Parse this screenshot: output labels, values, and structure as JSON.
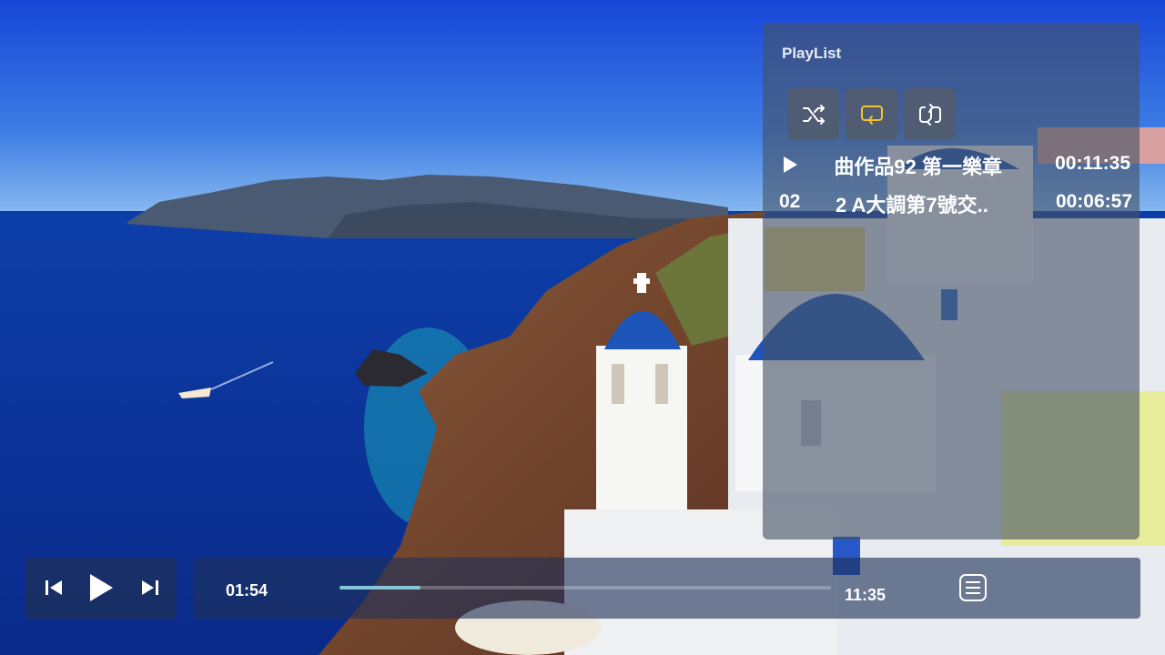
{
  "playlist": {
    "title": "PlayList",
    "modes": [
      {
        "name": "shuffle",
        "icon": "shuffle-icon",
        "active": false
      },
      {
        "name": "repeat-all",
        "icon": "repeat-all-icon",
        "active": true
      },
      {
        "name": "repeat-one",
        "icon": "repeat-one-icon",
        "active": false
      }
    ],
    "active_color": "#f2c230",
    "tracks": [
      {
        "number": "",
        "title": "曲作品92 第一樂章",
        "duration": "00:11:35",
        "playing": true
      },
      {
        "number": "02",
        "title": "2 A大調第7號交..",
        "duration": "00:06:57",
        "playing": false
      }
    ]
  },
  "player": {
    "current_time": "01:54",
    "total_time": "11:35",
    "progress_fraction": 0.164,
    "progress_color": "#86c6d8"
  }
}
